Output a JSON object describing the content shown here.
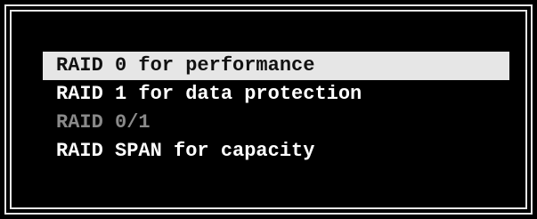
{
  "menu": {
    "items": [
      {
        "label": "RAID 0 for performance",
        "state": "selected"
      },
      {
        "label": "RAID 1 for data protection",
        "state": "normal"
      },
      {
        "label": "RAID 0/1",
        "state": "disabled"
      },
      {
        "label": "RAID SPAN for capacity",
        "state": "normal"
      }
    ]
  },
  "colors": {
    "background": "#000000",
    "border": "#e6e6e6",
    "text": "#ffffff",
    "selected_background": "#e6e6e6",
    "selected_text": "#111111",
    "disabled_text": "#8a8a8a"
  }
}
